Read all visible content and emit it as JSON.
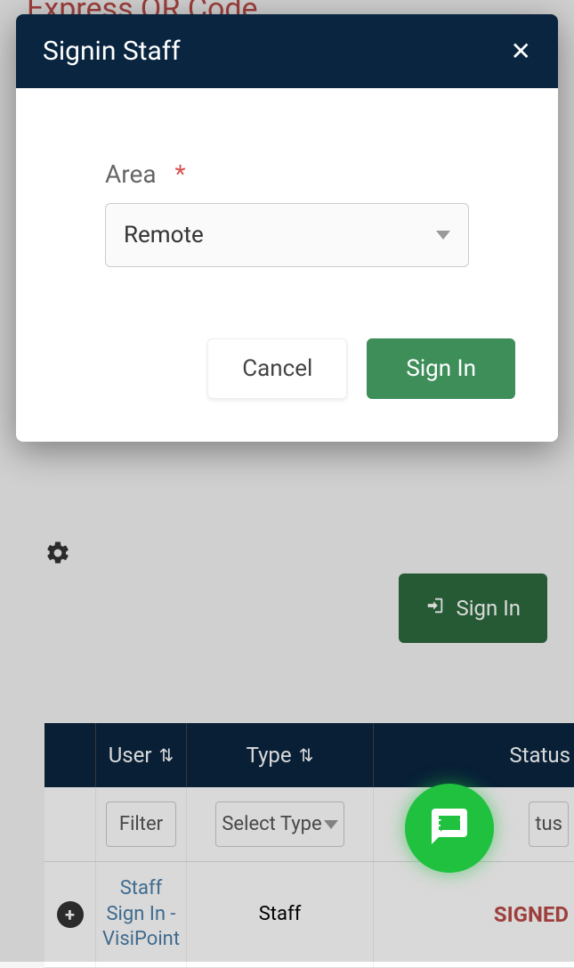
{
  "page": {
    "title": "Express QR Code"
  },
  "modal": {
    "title": "Signin Staff",
    "field_label": "Area",
    "required_mark": "*",
    "area_value": "Remote",
    "cancel_label": "Cancel",
    "signin_label": "Sign In"
  },
  "background": {
    "signin_label": "Sign In"
  },
  "table": {
    "headers": {
      "user": "User",
      "type": "Type",
      "status": "Status"
    },
    "filter_row": {
      "user_filter_placeholder": "Filter",
      "type_select_label": "Select Type",
      "status_select_partial": "tus"
    },
    "rows": [
      {
        "user": "Staff Sign In - VisiPoint",
        "type": "Staff",
        "status": "SIGNED"
      }
    ]
  }
}
